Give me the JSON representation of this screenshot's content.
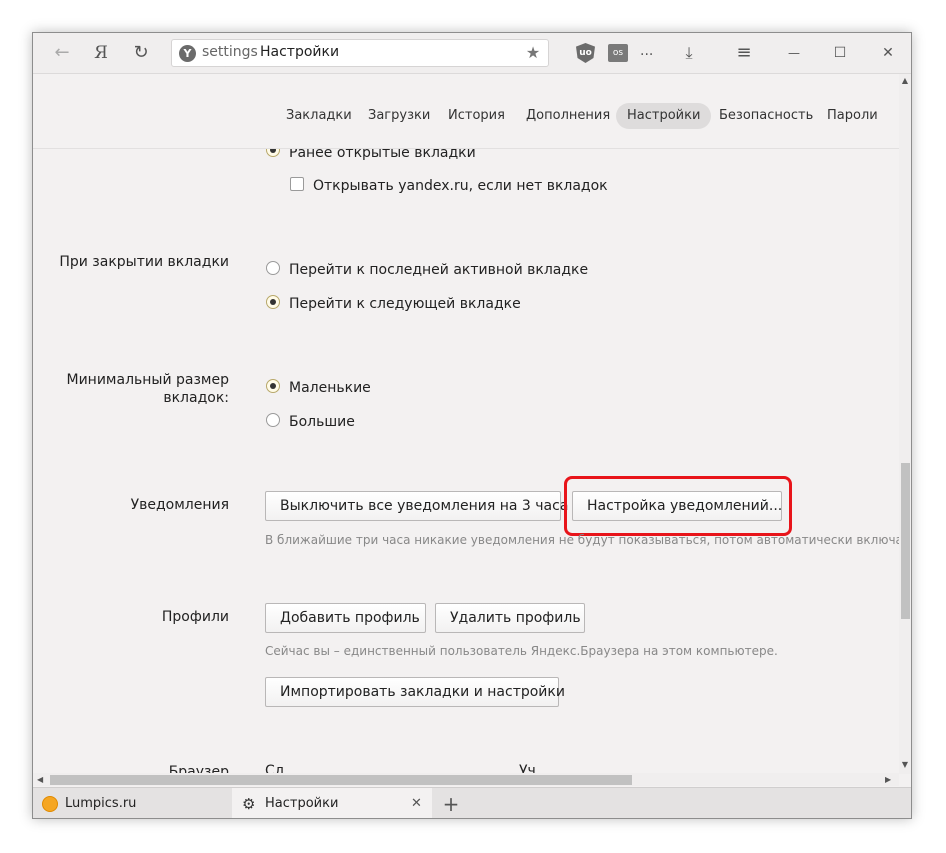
{
  "toolbar": {
    "back_glyph": "←",
    "yandex_glyph": "Я",
    "reload_glyph": "↻",
    "address_logo": "Y",
    "address_url": "settings",
    "address_title": "Настройки",
    "star_glyph": "★",
    "ublock_label": "uo",
    "lastfm_label": "os",
    "more_glyph": "...",
    "download_glyph": "⤓",
    "menu_glyph": "≡",
    "minimize_glyph": "—",
    "maximize_glyph": "☐",
    "close_glyph": "✕"
  },
  "nav": {
    "items": [
      "Закладки",
      "Загрузки",
      "История",
      "Дополнения",
      "Настройки",
      "Безопасность",
      "Пароли"
    ],
    "active": "Настройки"
  },
  "startup": {
    "option_previous": "Ранее открытые вкладки",
    "option_yandex": "Открывать yandex.ru, если нет вкладок"
  },
  "on_close": {
    "label": "При закрытии вкладки",
    "option_last_active": "Перейти к последней активной вкладке",
    "option_next": "Перейти к следующей вкладке"
  },
  "tab_size": {
    "label_line1": "Минимальный размер",
    "label_line2": "вкладок:",
    "option_small": "Маленькие",
    "option_large": "Большие"
  },
  "notifications": {
    "label": "Уведомления",
    "mute_button": "Выключить все уведомления на 3 часа",
    "settings_button": "Настройка уведомлений...",
    "hint": "В ближайшие три часа никакие уведомления не будут показываться, потом автоматически включатся."
  },
  "profiles": {
    "label": "Профили",
    "add_button": "Добавить профиль",
    "delete_button": "Удалить профиль",
    "hint": "Сейчас вы – единственный пользователь Яндекс.Браузера на этом компьютере.",
    "import_button": "Импортировать закладки и настройки"
  },
  "browser_partial": {
    "label": "Браузер",
    "col1": "Сд",
    "col2": "Уч"
  },
  "tabs": [
    {
      "title": "Lumpics.ru"
    },
    {
      "title": "Настройки",
      "close": "✕"
    }
  ],
  "new_tab_glyph": "+",
  "colors": {
    "highlight": "#e8141a",
    "window_bg": "#f3f1f1",
    "lumpics_fav": "#f5a623"
  }
}
